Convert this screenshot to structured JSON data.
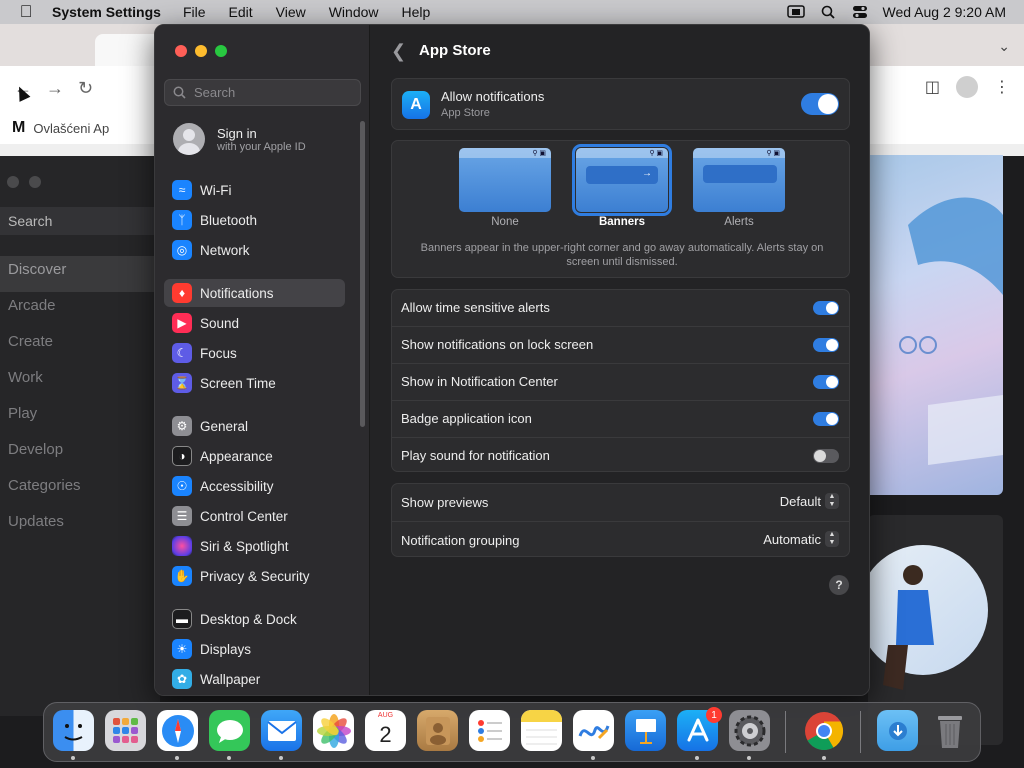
{
  "menubar": {
    "app_name": "System Settings",
    "items": [
      "File",
      "Edit",
      "View",
      "Window",
      "Help"
    ],
    "datetime": "Wed Aug 2  9:20 AM"
  },
  "chrome_bg": {
    "bookmark_text": "Ovlašćeni Ap",
    "bookmark_logo": "M"
  },
  "appstore_bg": {
    "search": "Search",
    "nav": [
      "Discover",
      "Arcade",
      "Create",
      "Work",
      "Play",
      "Develop",
      "Categories",
      "Updates"
    ]
  },
  "sidebar": {
    "search_placeholder": "Search",
    "signin_title": "Sign in",
    "signin_subtitle": "with your Apple ID",
    "items": [
      {
        "label": "Wi-Fi",
        "icon": "wifi-icon",
        "color": "#1a84ff"
      },
      {
        "label": "Bluetooth",
        "icon": "bluetooth-icon",
        "color": "#1a84ff"
      },
      {
        "label": "Network",
        "icon": "globe-icon",
        "color": "#1a84ff"
      },
      {
        "label": "Notifications",
        "icon": "bell-icon",
        "color": "#ff3b30"
      },
      {
        "label": "Sound",
        "icon": "speaker-icon",
        "color": "#ff2d55"
      },
      {
        "label": "Focus",
        "icon": "moon-icon",
        "color": "#5e5ce6"
      },
      {
        "label": "Screen Time",
        "icon": "hourglass-icon",
        "color": "#5e5ce6"
      },
      {
        "label": "General",
        "icon": "gear-icon",
        "color": "#8e8e93"
      },
      {
        "label": "Appearance",
        "icon": "appearance-icon",
        "color": "#1c1c1e"
      },
      {
        "label": "Accessibility",
        "icon": "accessibility-icon",
        "color": "#1a84ff"
      },
      {
        "label": "Control Center",
        "icon": "control-center-icon",
        "color": "#8e8e93"
      },
      {
        "label": "Siri & Spotlight",
        "icon": "siri-icon",
        "color": "#bf5af2"
      },
      {
        "label": "Privacy & Security",
        "icon": "hand-icon",
        "color": "#1a84ff"
      },
      {
        "label": "Desktop & Dock",
        "icon": "desktop-icon",
        "color": "#1c1c1e"
      },
      {
        "label": "Displays",
        "icon": "sun-icon",
        "color": "#1a84ff"
      },
      {
        "label": "Wallpaper",
        "icon": "wallpaper-icon",
        "color": "#32ade6"
      }
    ]
  },
  "content": {
    "title": "App Store",
    "allow": {
      "title": "Allow notifications",
      "subtitle": "App Store",
      "on": true
    },
    "styles": {
      "options": [
        "None",
        "Banners",
        "Alerts"
      ],
      "selected": "Banners",
      "description": "Banners appear in the upper-right corner and go away automatically. Alerts stay on screen until dismissed."
    },
    "toggles": [
      {
        "label": "Allow time sensitive alerts",
        "on": true
      },
      {
        "label": "Show notifications on lock screen",
        "on": true
      },
      {
        "label": "Show in Notification Center",
        "on": true
      },
      {
        "label": "Badge application icon",
        "on": true
      },
      {
        "label": "Play sound for notification",
        "on": false
      }
    ],
    "menus": [
      {
        "label": "Show previews",
        "value": "Default"
      },
      {
        "label": "Notification grouping",
        "value": "Automatic"
      }
    ],
    "help": "?"
  },
  "dock": {
    "calendar_month": "AUG",
    "calendar_day": "2",
    "appstore_badge": "1",
    "apps": [
      {
        "name": "finder-icon",
        "color": "#3b8ef0"
      },
      {
        "name": "launchpad-icon",
        "color": "#d8d8dc"
      },
      {
        "name": "safari-icon",
        "color": "#2a8cf5"
      },
      {
        "name": "messages-icon",
        "color": "#34c759"
      },
      {
        "name": "mail-icon",
        "color": "#1e8cf5"
      },
      {
        "name": "photos-icon",
        "color": "#ffffff"
      },
      {
        "name": "calendar-icon",
        "color": "#ffffff"
      },
      {
        "name": "contacts-icon",
        "color": "#c8975b"
      },
      {
        "name": "reminders-icon",
        "color": "#ffffff"
      },
      {
        "name": "notes-icon",
        "color": "#f7e27a"
      },
      {
        "name": "freeform-icon",
        "color": "#ffffff"
      },
      {
        "name": "keynote-icon",
        "color": "#1f8ef1"
      },
      {
        "name": "app-store-icon",
        "color": "#1a86f2"
      },
      {
        "name": "system-settings-icon",
        "color": "#8e8e93"
      },
      {
        "name": "chrome-icon",
        "color": "#ffffff"
      },
      {
        "name": "downloads-folder-icon",
        "color": "#5ab0ef"
      },
      {
        "name": "trash-icon",
        "color": "#6d6d72"
      }
    ]
  }
}
